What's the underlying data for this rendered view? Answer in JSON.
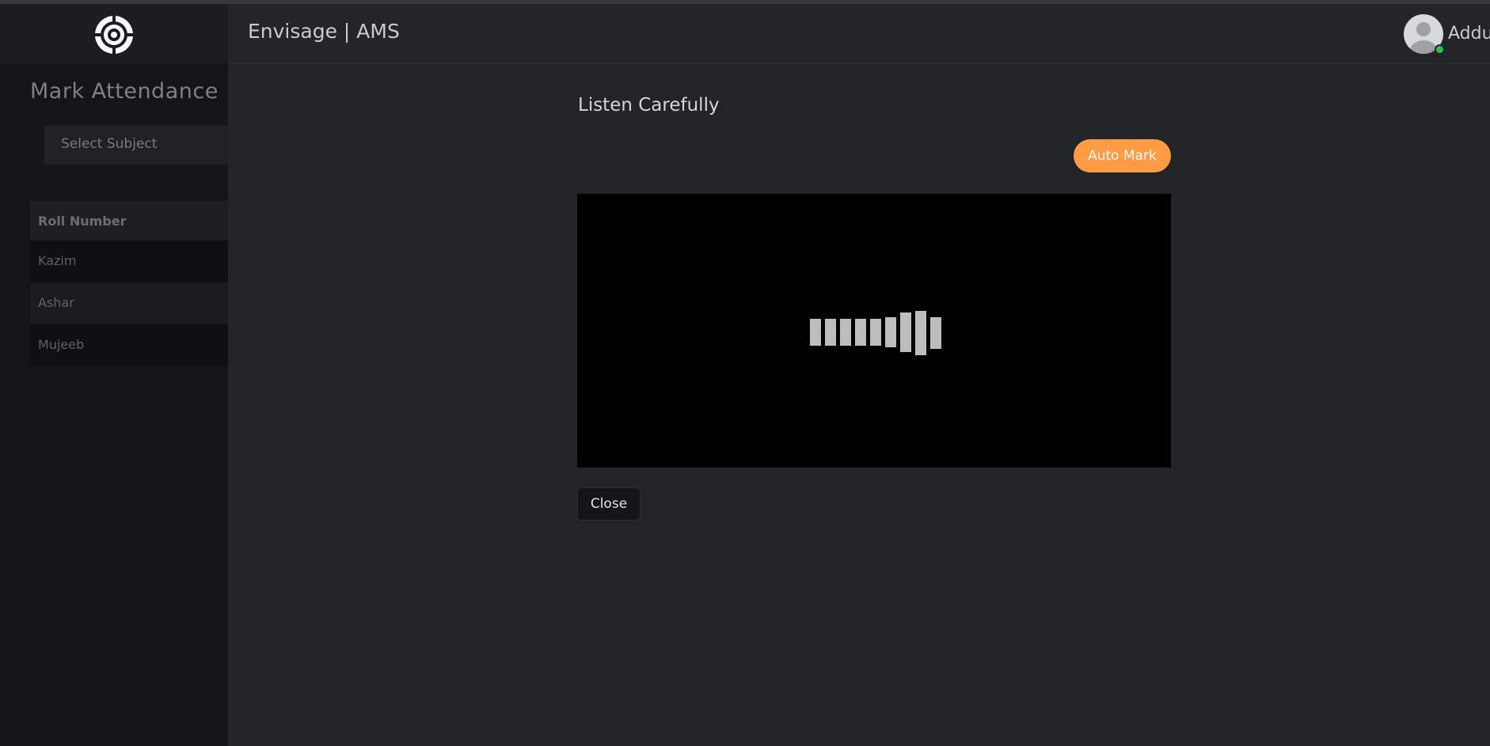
{
  "header": {
    "app_title": "Envisage | AMS",
    "user_name": "Addu"
  },
  "sidebar": {
    "logo": "target-logo-icon"
  },
  "background_page": {
    "title": "Mark Attendance",
    "select_placeholder": "Select Subject",
    "table": {
      "column_header": "Roll Number",
      "rows": [
        "Kazim",
        "Ashar",
        "Mujeeb"
      ]
    }
  },
  "modal": {
    "title": "Listen Carefully",
    "auto_mark_label": "Auto Mark",
    "close_label": "Close",
    "audio_visualizer": "equalizer-icon"
  },
  "colors": {
    "accent": "#ff9b45",
    "online": "#2fbf4a",
    "background": "#222428",
    "sidebar": "#141517"
  }
}
